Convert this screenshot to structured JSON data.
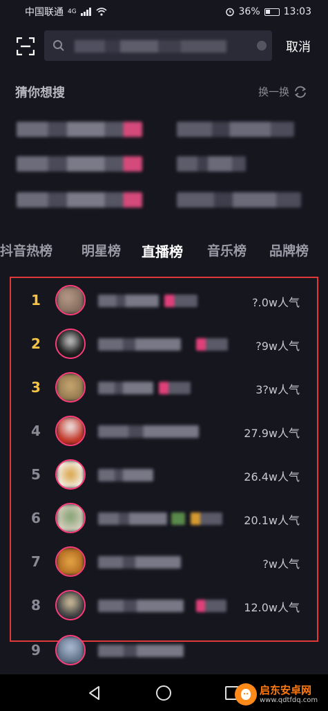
{
  "status": {
    "carrier": "中国联通",
    "network": "4G",
    "battery": "36%",
    "time": "13:03"
  },
  "search": {
    "cancel_label": "取消"
  },
  "guess": {
    "title": "猜你想搜",
    "refresh_label": "换一换"
  },
  "tabs": [
    {
      "label": "抖音热榜",
      "active": false
    },
    {
      "label": "明星榜",
      "active": false
    },
    {
      "label": "直播榜",
      "active": true
    },
    {
      "label": "音乐榜",
      "active": false
    },
    {
      "label": "品牌榜",
      "active": false
    }
  ],
  "rankings": [
    {
      "rank": "1",
      "popularity": "?.0w人气"
    },
    {
      "rank": "2",
      "popularity": "?9w人气"
    },
    {
      "rank": "3",
      "popularity": "3?w人气"
    },
    {
      "rank": "4",
      "popularity": "27.9w人气"
    },
    {
      "rank": "5",
      "popularity": "26.4w人气"
    },
    {
      "rank": "6",
      "popularity": "20.1w人气"
    },
    {
      "rank": "7",
      "popularity": "?w人气"
    },
    {
      "rank": "8",
      "popularity": "12.0w人气"
    },
    {
      "rank": "9",
      "popularity": ""
    }
  ],
  "colors": {
    "background": "#16161f",
    "highlight_frame": "#e03838",
    "top_rank": "#f6c445",
    "avatar_ring": "#ff3d7a"
  },
  "watermark": {
    "title": "启东安卓网",
    "url": "www.qdtfdq.com"
  }
}
